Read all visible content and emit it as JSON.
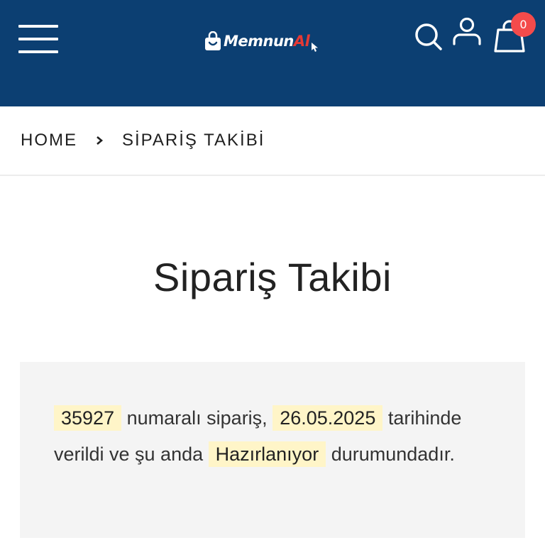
{
  "header": {
    "logo": {
      "text_main": "Memnun",
      "text_accent": "Al"
    },
    "cart_count": "0",
    "colors": {
      "background": "#0c3f72",
      "logo_accent": "#e53935",
      "badge": "#f44b4b"
    },
    "icons": {
      "menu": "hamburger-icon",
      "search": "search-icon",
      "user": "user-icon",
      "cart": "shopping-bag-icon"
    }
  },
  "breadcrumb": {
    "home": "HOME",
    "current": "SİPARİŞ TAKİBİ"
  },
  "page": {
    "title": "Sipariş Takibi"
  },
  "order_status": {
    "order_number": "35927",
    "text_1": "numaralı sipariş,",
    "date": "26.05.2025",
    "text_2": "tarihinde verildi ve şu anda",
    "status": "Hazırlanıyor",
    "text_3": "durumundadır.",
    "highlight_color": "#fff5c8"
  }
}
